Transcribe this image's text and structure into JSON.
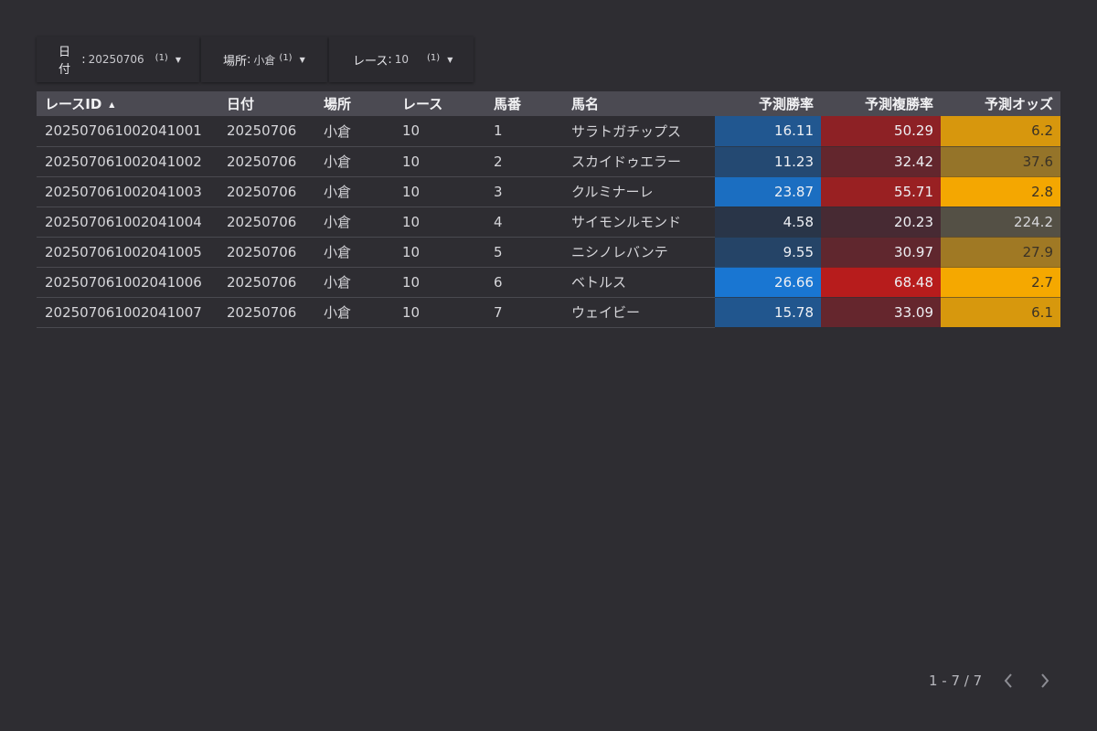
{
  "filters": [
    {
      "label": "日付",
      "value": "20250706",
      "count": "(1)"
    },
    {
      "label": "場所",
      "value": "小倉",
      "count": "(1)"
    },
    {
      "label": "レース",
      "value": "10",
      "count": "(1)"
    }
  ],
  "table": {
    "columns": [
      "レースID",
      "日付",
      "場所",
      "レース",
      "馬番",
      "馬名",
      "予測勝率",
      "予測複勝率",
      "予測オッズ"
    ],
    "sorted_column": "レースID",
    "sort_direction": "ascending",
    "rows": [
      {
        "race_id": "202507061002041001",
        "date": "20250706",
        "place": "小倉",
        "race": "10",
        "horse_no": "1",
        "horse_name": "サラトガチップス",
        "win_rate": "16.11",
        "place_rate": "50.29",
        "odds": "6.2"
      },
      {
        "race_id": "202507061002041002",
        "date": "20250706",
        "place": "小倉",
        "race": "10",
        "horse_no": "2",
        "horse_name": "スカイドゥエラー",
        "win_rate": "11.23",
        "place_rate": "32.42",
        "odds": "37.6"
      },
      {
        "race_id": "202507061002041003",
        "date": "20250706",
        "place": "小倉",
        "race": "10",
        "horse_no": "3",
        "horse_name": "クルミナーレ",
        "win_rate": "23.87",
        "place_rate": "55.71",
        "odds": "2.8"
      },
      {
        "race_id": "202507061002041004",
        "date": "20250706",
        "place": "小倉",
        "race": "10",
        "horse_no": "4",
        "horse_name": "サイモンルモンド",
        "win_rate": "4.58",
        "place_rate": "20.23",
        "odds": "224.2"
      },
      {
        "race_id": "202507061002041005",
        "date": "20250706",
        "place": "小倉",
        "race": "10",
        "horse_no": "5",
        "horse_name": "ニシノレバンテ",
        "win_rate": "9.55",
        "place_rate": "30.97",
        "odds": "27.9"
      },
      {
        "race_id": "202507061002041006",
        "date": "20250706",
        "place": "小倉",
        "race": "10",
        "horse_no": "6",
        "horse_name": "ベトルス",
        "win_rate": "26.66",
        "place_rate": "68.48",
        "odds": "2.7"
      },
      {
        "race_id": "202507061002041007",
        "date": "20250706",
        "place": "小倉",
        "race": "10",
        "horse_no": "7",
        "horse_name": "ウェイビー",
        "win_rate": "15.78",
        "place_rate": "33.09",
        "odds": "6.1"
      }
    ]
  },
  "heatmap_colors": {
    "win_rate": {
      "low": "#293548",
      "high": "#1976d2"
    },
    "place_rate": {
      "low": "#472a33",
      "high": "#b71c1c"
    },
    "odds": {
      "low": "#f5a800",
      "high": "#545045"
    }
  },
  "pagination": {
    "range": "1 - 7 / 7",
    "prev_icon": "chevron-left-icon",
    "next_icon": "chevron-right-icon"
  }
}
